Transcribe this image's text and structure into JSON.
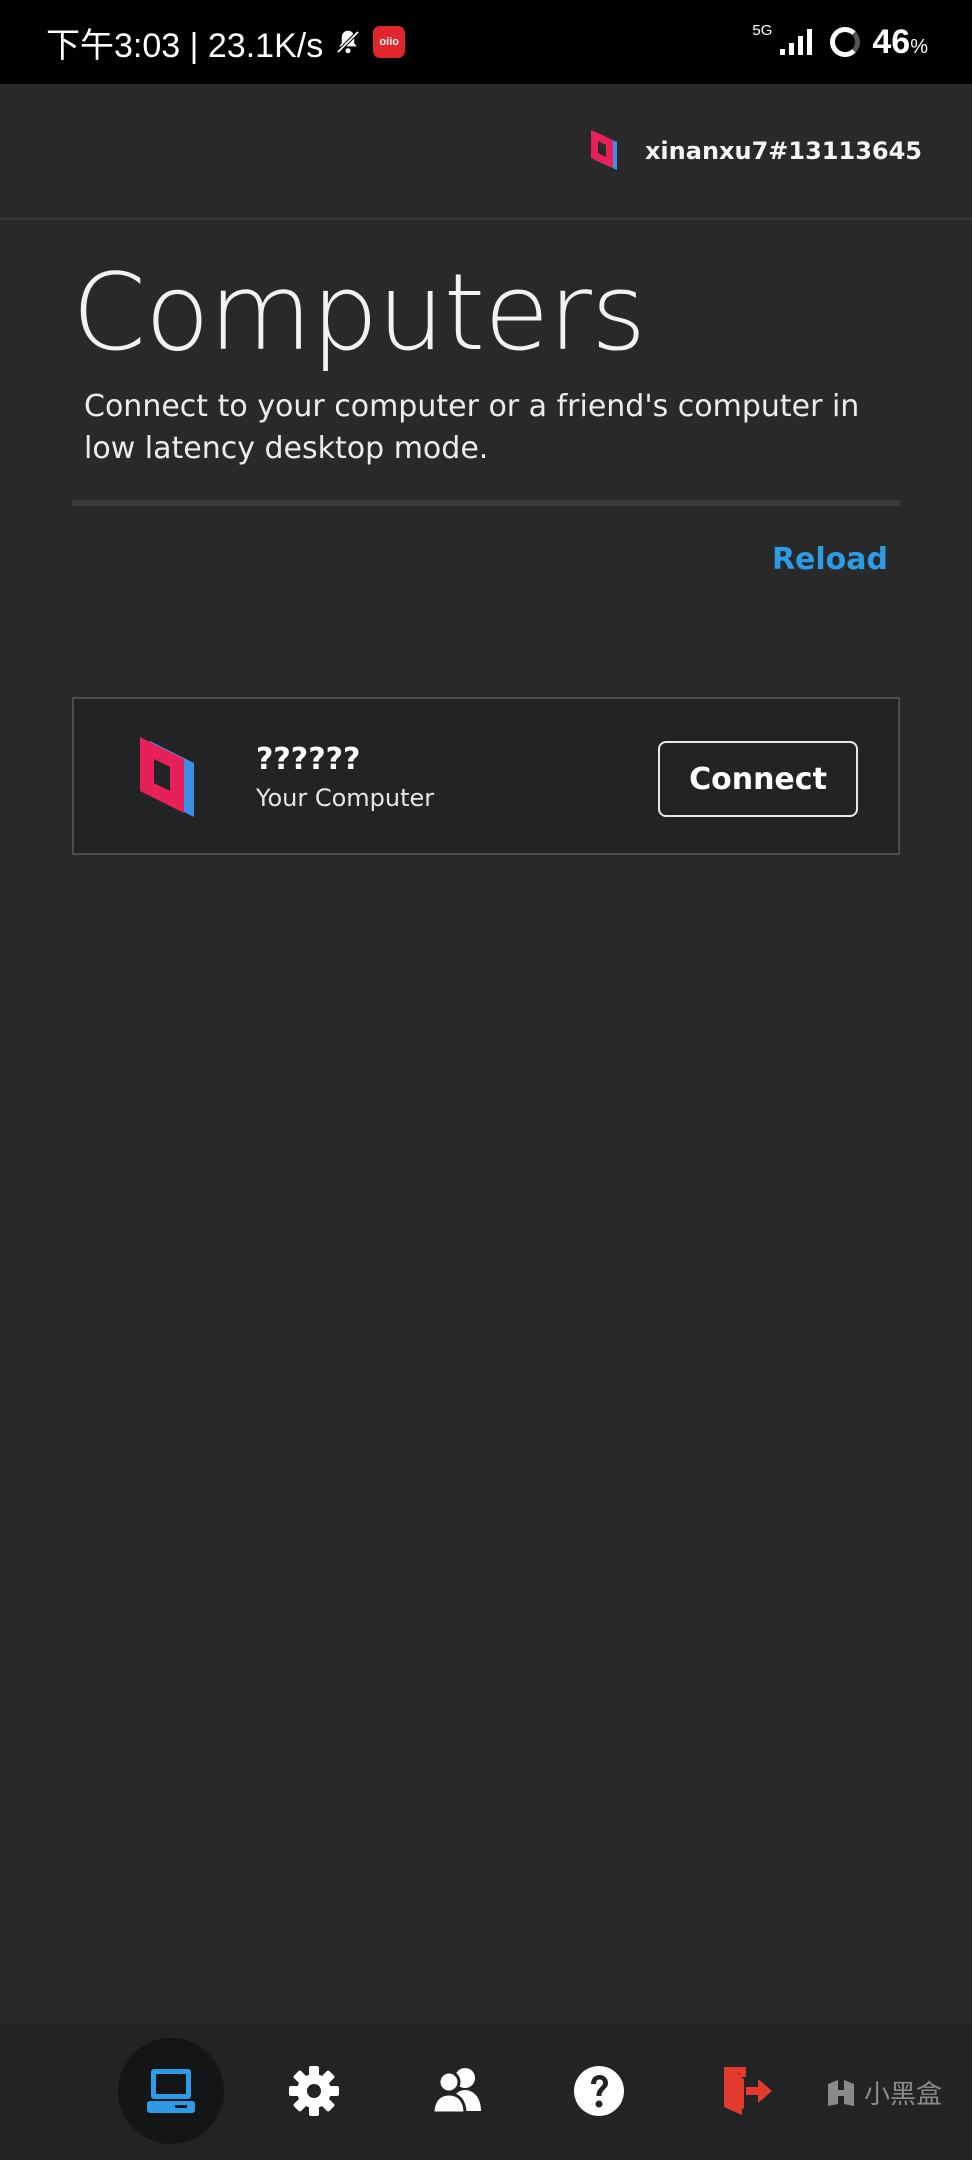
{
  "status_bar": {
    "time_speed": "下午3:03 | 23.1K/s",
    "app_badge": "oiio",
    "network": "5G",
    "battery": "46",
    "battery_unit": "%"
  },
  "header": {
    "username": "xinanxu7#13113645"
  },
  "main": {
    "title": "Computers",
    "description": "Connect to your computer or a friend's computer in low latency desktop mode.",
    "reload_label": "Reload"
  },
  "computers": [
    {
      "name": "??????",
      "subtitle": "Your Computer",
      "connect_label": "Connect"
    }
  ],
  "nav": {
    "items": [
      "computers",
      "settings",
      "friends",
      "help",
      "logout"
    ],
    "active": "computers"
  },
  "watermark": {
    "text": "小黑盒"
  },
  "colors": {
    "accent_blue": "#2d9be6",
    "brand_pink": "#e8205a",
    "logout_red": "#e23b2e",
    "background": "#292929",
    "card": "#222325"
  }
}
